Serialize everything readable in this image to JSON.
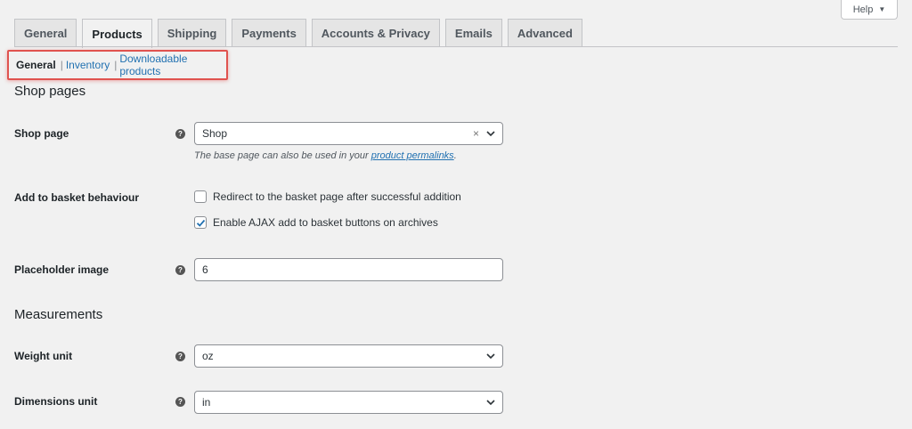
{
  "help": {
    "label": "Help",
    "icon": "caret-down-icon"
  },
  "tabs": [
    {
      "label": "General",
      "active": false
    },
    {
      "label": "Products",
      "active": true
    },
    {
      "label": "Shipping",
      "active": false
    },
    {
      "label": "Payments",
      "active": false
    },
    {
      "label": "Accounts & Privacy",
      "active": false
    },
    {
      "label": "Emails",
      "active": false
    },
    {
      "label": "Advanced",
      "active": false
    }
  ],
  "subnav": {
    "current": "General",
    "separator": "|",
    "links": [
      "Inventory",
      "Downloadable products"
    ]
  },
  "shop_pages": {
    "title": "Shop pages",
    "shop_page": {
      "label": "Shop page",
      "value": "Shop",
      "clear": "×",
      "desc_text": "The base page can also be used in your ",
      "desc_link": "product permalinks",
      "desc_end": "."
    },
    "add_to_basket": {
      "label": "Add to basket behaviour",
      "options": [
        {
          "label": "Redirect to the basket page after successful addition",
          "checked": false
        },
        {
          "label": "Enable AJAX add to basket buttons on archives",
          "checked": true
        }
      ]
    },
    "placeholder": {
      "label": "Placeholder image",
      "value": "6"
    }
  },
  "measurements": {
    "title": "Measurements",
    "weight": {
      "label": "Weight unit",
      "value": "oz"
    },
    "dimensions": {
      "label": "Dimensions unit",
      "value": "in"
    }
  },
  "colors": {
    "link": "#2271b1",
    "highlight": "#e0534f",
    "check": "#2271b1"
  }
}
